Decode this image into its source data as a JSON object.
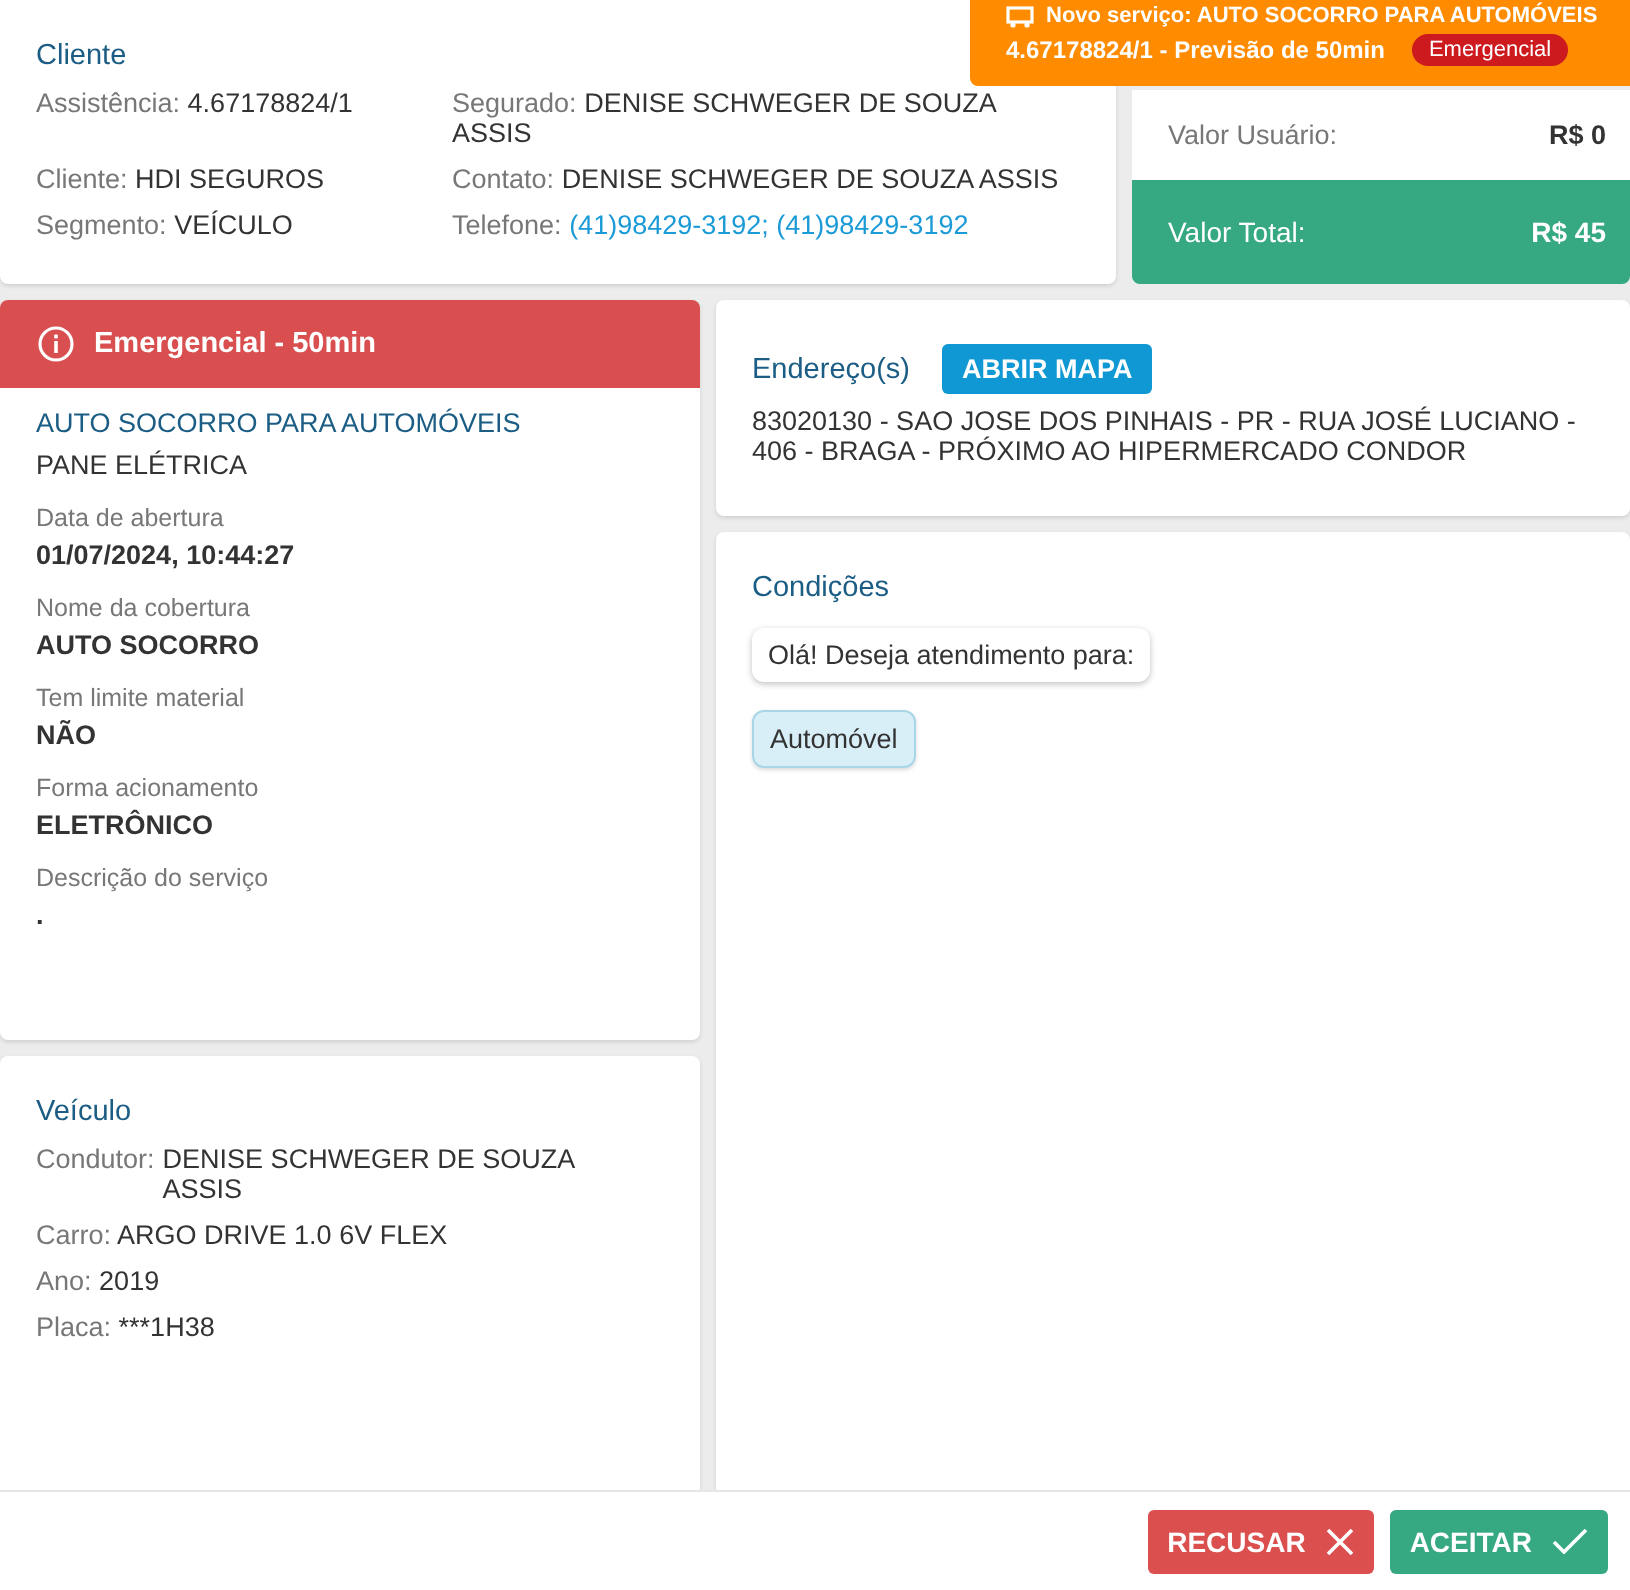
{
  "notification": {
    "title": "Novo serviço: AUTO SOCORRO PARA AUTOMÓVEIS",
    "subtitle": "4.67178824/1 - Previsão de 50min",
    "badge": "Emergencial"
  },
  "cliente": {
    "title": "Cliente",
    "fields": [
      {
        "label": "Assistência:",
        "value": "4.67178824/1",
        "kind": "text"
      },
      {
        "label": "Segurado:",
        "value": "DENISE SCHWEGER DE SOUZA ASSIS",
        "kind": "text"
      },
      {
        "label": "Cliente:",
        "value": "HDI SEGUROS",
        "kind": "text"
      },
      {
        "label": "Contato:",
        "value": "DENISE SCHWEGER DE SOUZA ASSIS",
        "kind": "text"
      },
      {
        "label": "Segmento:",
        "value": "VEÍCULO",
        "kind": "text"
      },
      {
        "label": "Telefone:",
        "value": "(41)98429-3192; (41)98429-3192",
        "kind": "link"
      }
    ]
  },
  "valores": [
    {
      "label": "Valor Usuário:",
      "value": "R$ 0",
      "kind": "plain"
    },
    {
      "label": "Valor Total:",
      "value": "R$ 45",
      "kind": "total"
    }
  ],
  "servico": {
    "header": "Emergencial - 50min",
    "title": "AUTO SOCORRO PARA AUTOMÓVEIS",
    "subtitle": "PANE ELÉTRICA",
    "fields": [
      {
        "label": "Data de abertura",
        "value": "01/07/2024, 10:44:27"
      },
      {
        "label": "Nome da cobertura",
        "value": "AUTO SOCORRO"
      },
      {
        "label": "Tem limite material",
        "value": "NÃO"
      },
      {
        "label": "Forma acionamento",
        "value": "ELETRÔNICO"
      },
      {
        "label": "Descrição do serviço",
        "value": "."
      }
    ]
  },
  "veiculo": {
    "title": "Veículo",
    "fields": [
      {
        "label": "Condutor:",
        "value": "DENISE SCHWEGER DE SOUZA ASSIS"
      },
      {
        "label": "Carro:",
        "value": "ARGO DRIVE 1.0 6V FLEX"
      },
      {
        "label": "Ano:",
        "value": "2019"
      },
      {
        "label": "Placa:",
        "value": "***1H38"
      }
    ]
  },
  "endereco": {
    "title": "Endereço(s)",
    "button": "ABRIR MAPA",
    "text": "83020130 - SAO JOSE DOS PINHAIS - PR - RUA JOSÉ LUCIANO - 406 - BRAGA - PRÓXIMO AO HIPERMERCADO CONDOR"
  },
  "condicoes": {
    "title": "Condições",
    "messages": [
      {
        "text": "Olá! Deseja atendimento para:",
        "kind": "question"
      },
      {
        "text": "Automóvel",
        "kind": "option"
      }
    ]
  },
  "buttons": [
    {
      "label": "RECUSAR",
      "kind": "reject"
    },
    {
      "label": "ACEITAR",
      "kind": "accept"
    }
  ]
}
